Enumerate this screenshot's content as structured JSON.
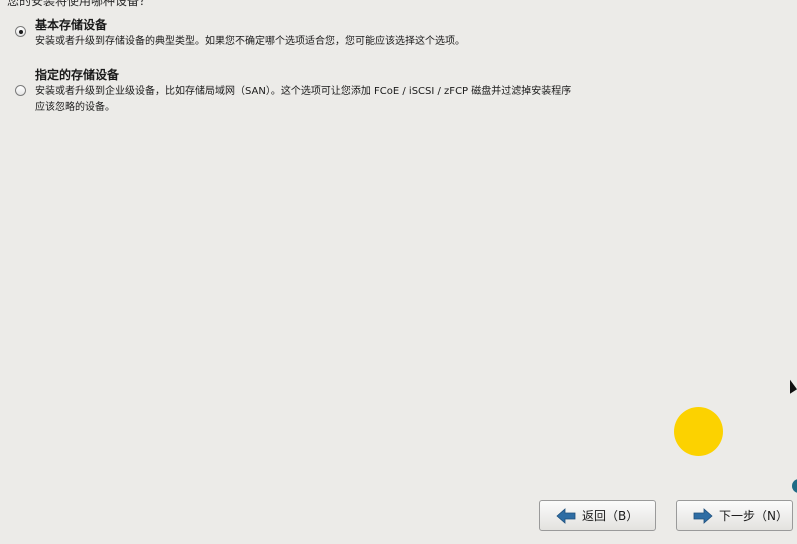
{
  "header": {
    "clipped_text": "您的安装将使用哪种设备？"
  },
  "options": [
    {
      "title": "基本存储设备",
      "description_lines": [
        "安装或者升级到存储设备的典型类型。如果您不确定哪个选项适合您，您可能应该选择这个选项。"
      ],
      "selected": true
    },
    {
      "title": "指定的存储设备",
      "description_lines": [
        "安装或者升级到企业级设备，比如存储局域网（SAN）。这个选项可让您添加 FCoE / iSCSI / zFCP 磁盘并过滤掉安装程序",
        "应该忽略的设备。"
      ],
      "selected": false
    }
  ],
  "buttons": {
    "back_label": "返回（B）",
    "next_label": "下一步（N）",
    "back_icon": "arrow-left-icon",
    "next_icon": "arrow-right-icon"
  },
  "colors": {
    "background": "#ecebe8",
    "cursor_indicator": "#fcd200",
    "arrow_icon": "#2e6da4"
  }
}
